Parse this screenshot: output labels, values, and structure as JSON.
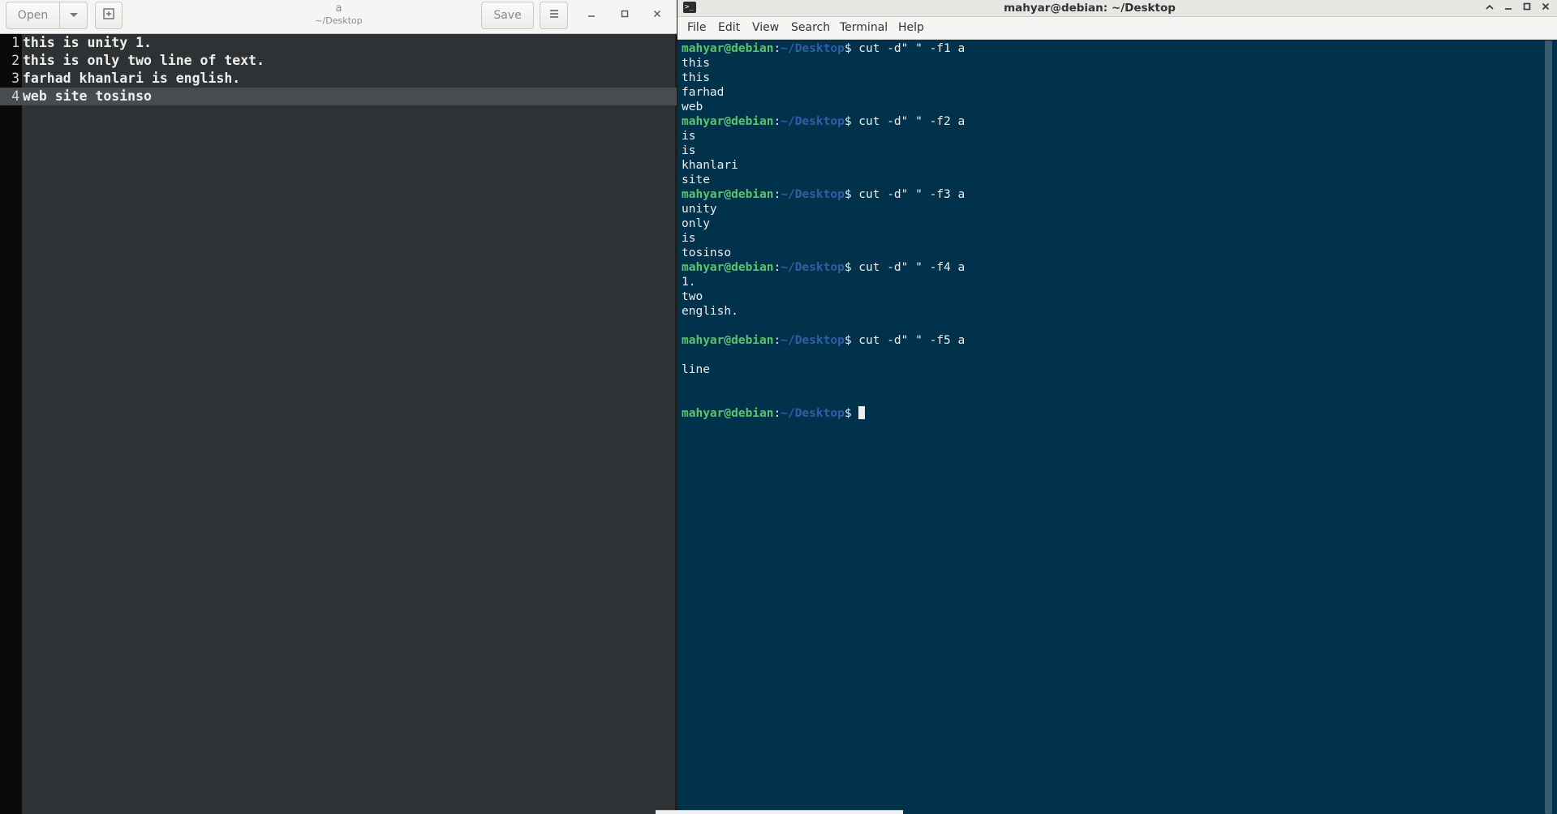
{
  "editor": {
    "open_label": "Open",
    "save_label": "Save",
    "title": "a",
    "subtitle": "~/Desktop",
    "lines": [
      {
        "num": "1",
        "text": "this is unity 1."
      },
      {
        "num": "2",
        "text": "this is only two line of text."
      },
      {
        "num": "3",
        "text": "farhad khanlari is english."
      },
      {
        "num": "4",
        "text": "web site tosinso"
      }
    ],
    "current_line": 4
  },
  "terminal": {
    "title": "mahyar@debian: ~/Desktop",
    "menu": [
      "File",
      "Edit",
      "View",
      "Search",
      "Terminal",
      "Help"
    ],
    "prompt_user": "mahyar@debian",
    "prompt_sep": ":",
    "prompt_path": "~/Desktop",
    "prompt_symbol": "$ ",
    "lines": [
      {
        "type": "prompt",
        "cmd": "cut -d\" \" -f1 a"
      },
      {
        "type": "out",
        "text": "this"
      },
      {
        "type": "out",
        "text": "this"
      },
      {
        "type": "out",
        "text": "farhad"
      },
      {
        "type": "out",
        "text": "web"
      },
      {
        "type": "prompt",
        "cmd": "cut -d\" \" -f2 a"
      },
      {
        "type": "out",
        "text": "is"
      },
      {
        "type": "out",
        "text": "is"
      },
      {
        "type": "out",
        "text": "khanlari"
      },
      {
        "type": "out",
        "text": "site"
      },
      {
        "type": "prompt",
        "cmd": "cut -d\" \" -f3 a"
      },
      {
        "type": "out",
        "text": "unity"
      },
      {
        "type": "out",
        "text": "only"
      },
      {
        "type": "out",
        "text": "is"
      },
      {
        "type": "out",
        "text": "tosinso"
      },
      {
        "type": "prompt",
        "cmd": "cut -d\" \" -f4 a"
      },
      {
        "type": "out",
        "text": "1."
      },
      {
        "type": "out",
        "text": "two"
      },
      {
        "type": "out",
        "text": "english."
      },
      {
        "type": "out",
        "text": ""
      },
      {
        "type": "prompt",
        "cmd": "cut -d\" \" -f5 a"
      },
      {
        "type": "out",
        "text": ""
      },
      {
        "type": "out",
        "text": "line"
      },
      {
        "type": "out",
        "text": ""
      },
      {
        "type": "out",
        "text": ""
      },
      {
        "type": "prompt",
        "cmd": "",
        "cursor": true
      }
    ]
  },
  "colors": {
    "editor_bg": "#2e3235",
    "terminal_bg": "#00324b",
    "prompt_user": "#5ec46a",
    "prompt_path": "#2f5fa8"
  }
}
